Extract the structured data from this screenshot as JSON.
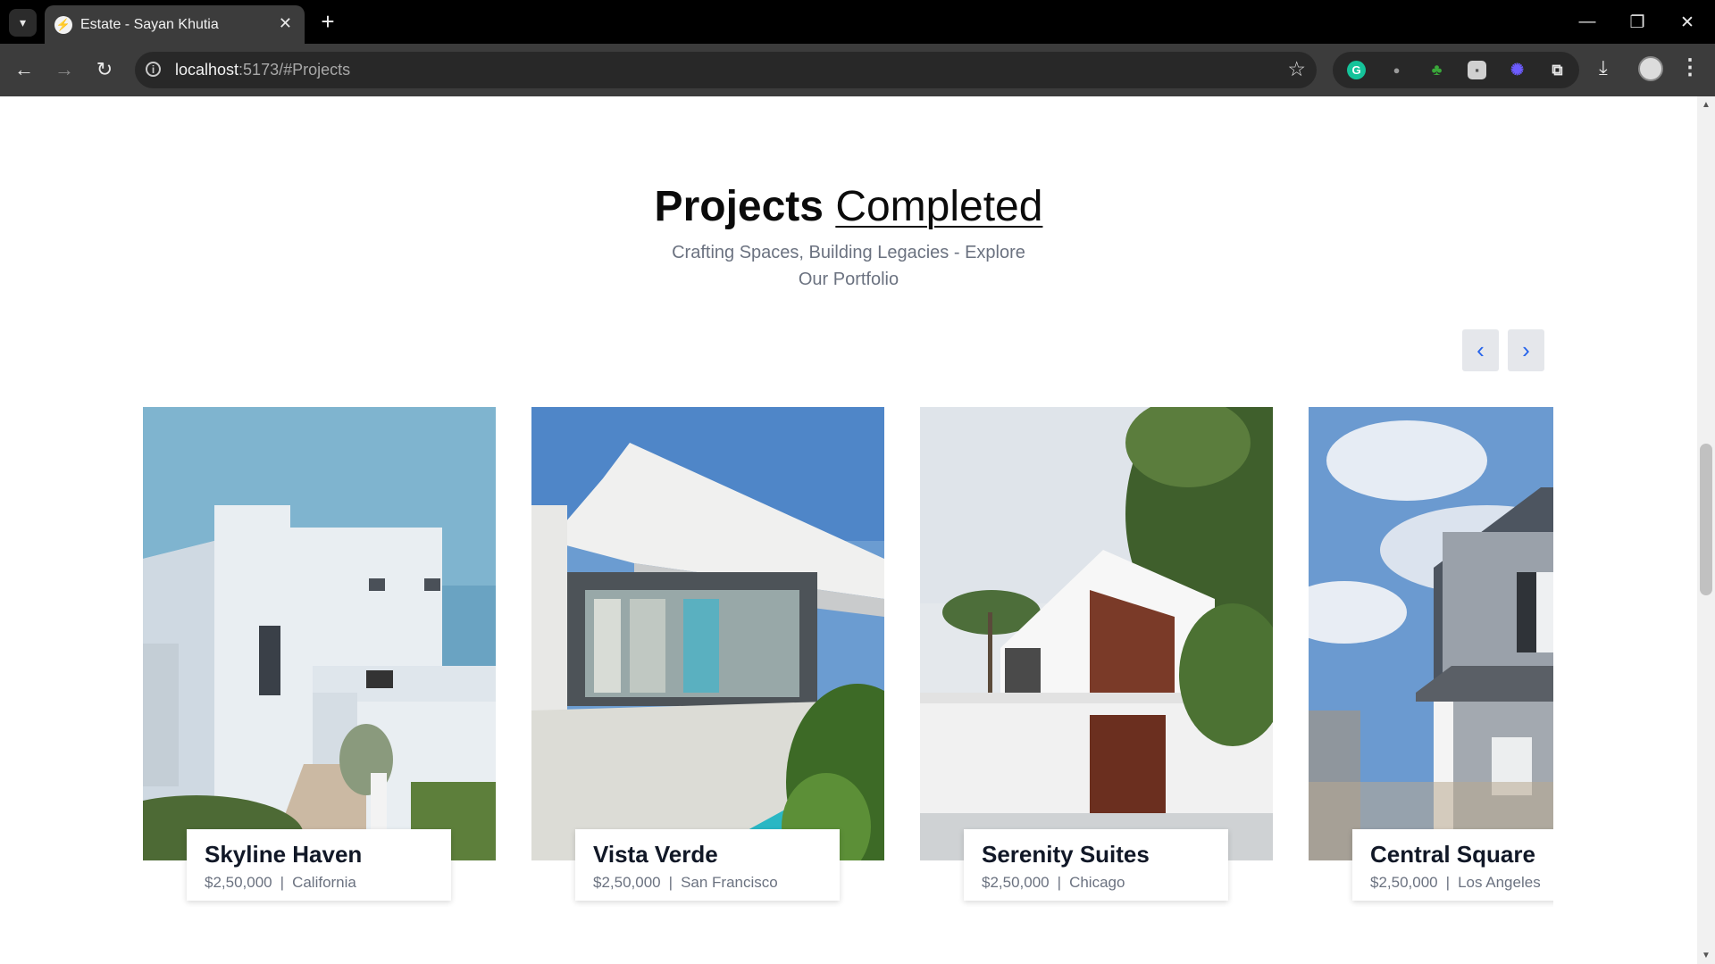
{
  "browser": {
    "tab_title": "Estate - Sayan Khutia",
    "url_host": "localhost",
    "url_rest": ":5173/#Projects",
    "new_tab_glyph": "+",
    "close_glyph": "✕"
  },
  "section": {
    "title_strong": "Projects",
    "title_light": "Completed",
    "subtitle_line1": "Crafting Spaces, Building Legacies - Explore",
    "subtitle_line2": "Our Portfolio"
  },
  "carousel": {
    "prev_glyph": "‹",
    "next_glyph": "›",
    "projects": [
      {
        "name": "Skyline Haven",
        "price": "$2,50,000",
        "location": "California"
      },
      {
        "name": "Vista Verde",
        "price": "$2,50,000",
        "location": "San Francisco"
      },
      {
        "name": "Serenity Suites",
        "price": "$2,50,000",
        "location": "Chicago"
      },
      {
        "name": "Central Square",
        "price": "$2,50,000",
        "location": "Los Angeles"
      }
    ],
    "separator": "|"
  },
  "icons": {
    "tab_search": "chevron-down-icon",
    "back": "arrow-left-icon",
    "forward": "arrow-right-icon",
    "reload": "reload-icon",
    "site_info": "info-icon",
    "bookmark": "star-icon",
    "downloads": "download-icon",
    "menu": "kebab-menu-icon"
  },
  "colors": {
    "accent": "#2563eb",
    "button_bg": "#e5e7eb",
    "muted_text": "#6b7280"
  }
}
